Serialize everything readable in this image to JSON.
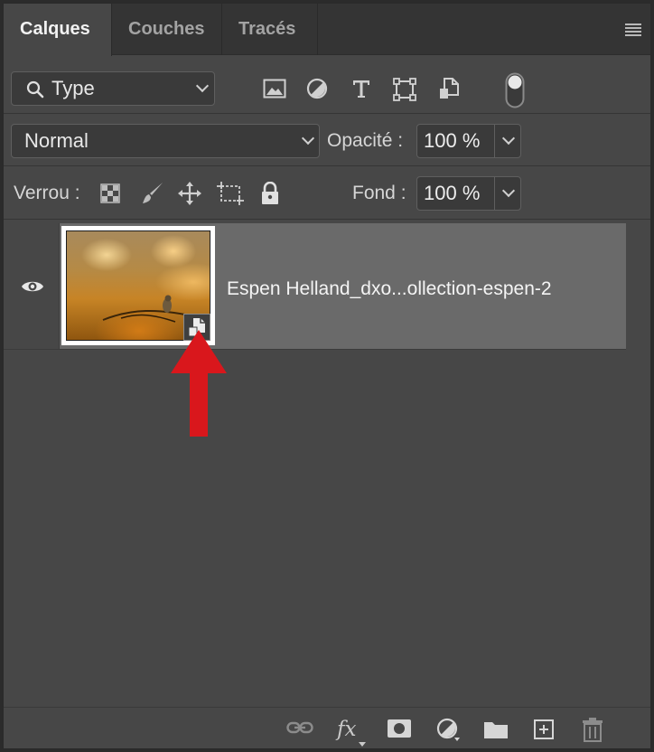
{
  "tabs": [
    {
      "label": "Calques",
      "active": true
    },
    {
      "label": "Couches",
      "active": false
    },
    {
      "label": "Tracés",
      "active": false
    }
  ],
  "filter": {
    "selected": "Type",
    "icon": "search-icon"
  },
  "filter_icons": [
    "image-filter-icon",
    "adjustment-filter-icon",
    "type-filter-icon",
    "shape-filter-icon",
    "smart-object-filter-icon",
    "filter-toggle-icon"
  ],
  "blend": {
    "selected": "Normal"
  },
  "opacity": {
    "label": "Opacité :",
    "value": "100 %"
  },
  "lock": {
    "label": "Verrou :",
    "icons": [
      "lock-transparent-icon",
      "lock-image-icon",
      "lock-position-icon",
      "lock-artboard-icon",
      "lock-all-icon"
    ]
  },
  "fill": {
    "label": "Fond :",
    "value": "100 %"
  },
  "layers": [
    {
      "name": "Espen Helland_dxo...ollection-espen-2",
      "visible": true,
      "type": "smart-object",
      "selected": true
    }
  ],
  "annotation": {
    "arrow_color": "#d9171c",
    "points_to": "smart-object-badge"
  },
  "footer_icons": [
    "link-layers-icon",
    "fx-icon",
    "layer-mask-icon",
    "adjustment-layer-icon",
    "group-folder-icon",
    "new-layer-icon",
    "trash-icon"
  ],
  "footer": {
    "fx_label": "fx"
  },
  "colors": {
    "panel_bg": "#474747",
    "tab_bar_bg": "#343434",
    "selected_layer_bg": "#6a6a6a",
    "field_bg": "#3a3a3a"
  }
}
